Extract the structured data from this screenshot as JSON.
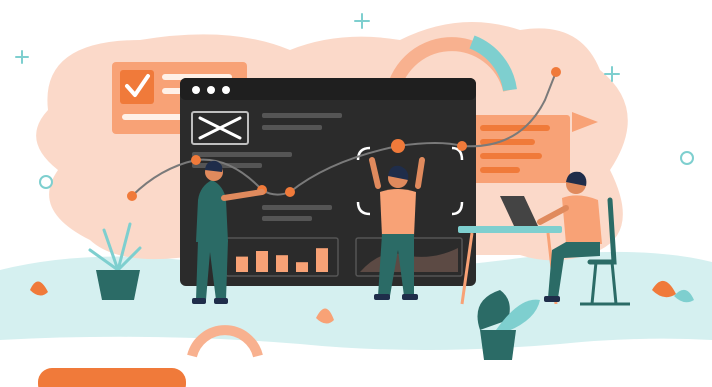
{
  "illustration": {
    "colors": {
      "peach_blob": "#fbd9c9",
      "ground": "#d5f0f0",
      "orange": "#f07a3a",
      "orange_light": "#f8a276",
      "teal": "#2b6b66",
      "teal_light": "#7ecfcf",
      "dark_panel": "#2b2b2b",
      "dark_bar": "#3a3a3a",
      "skin": "#e08a5d",
      "navy": "#1f2d4a"
    },
    "icons": [
      "checkmark-icon",
      "close-icon",
      "plus-icon",
      "circle-icon",
      "leaf-icon",
      "plant-icon",
      "laptop-icon"
    ],
    "bar_chart_levels": [
      0.55,
      0.75,
      0.6,
      0.35,
      0.85
    ]
  }
}
